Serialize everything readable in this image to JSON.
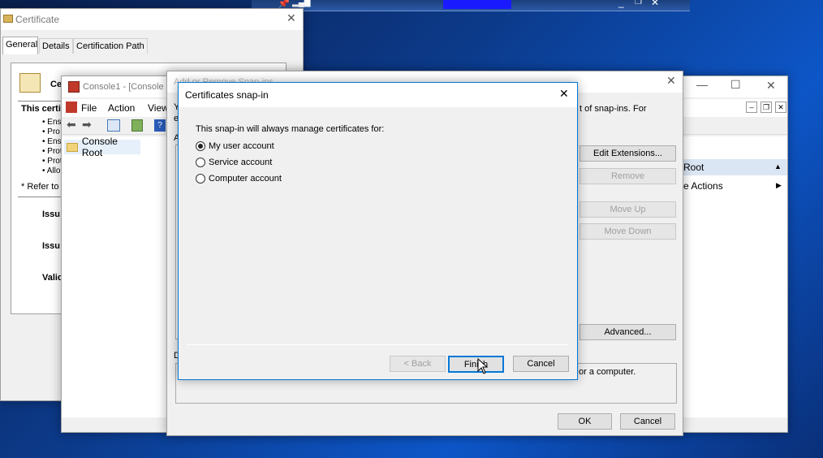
{
  "taskbar": {
    "title": ""
  },
  "certificate": {
    "title": "Certificate",
    "tabs": [
      "General",
      "Details",
      "Certification Path"
    ],
    "heading_fragment": "Ce",
    "info_fragment": "This certi",
    "bullets": [
      "• Ens",
      "• Pro",
      "• Ens",
      "• Prot",
      "• Prot",
      "• Allo"
    ],
    "refer_fragment": "* Refer to",
    "issued_fragment_1": "Issu",
    "issued_fragment_2": "Issu",
    "valid_fragment": "Valid"
  },
  "console": {
    "title": "Console1 - [Console",
    "menu": [
      "File",
      "Action",
      "View"
    ],
    "tree_root": "Console Root",
    "actions_root": "Root",
    "actions_more": "e Actions"
  },
  "snapins": {
    "title": "Add or Remove Snap-ins",
    "desc_fragment": "t of snap-ins. For",
    "desc_y": "Y",
    "desc_e": "e",
    "label_a": "A",
    "label_d": "D",
    "btn_edit_ext": "Edit Extensions...",
    "btn_remove": "Remove",
    "btn_move_up": "Move Up",
    "btn_move_down": "Move Down",
    "btn_advanced": "Advanced...",
    "description_fragment": "or a computer.",
    "btn_ok": "OK",
    "btn_cancel": "Cancel"
  },
  "dialog": {
    "title": "Certificates snap-in",
    "prompt": "This snap-in will always manage certificates for:",
    "options": [
      {
        "label": "My user account",
        "selected": true
      },
      {
        "label": "Service account",
        "selected": false
      },
      {
        "label": "Computer account",
        "selected": false
      }
    ],
    "btn_back": "< Back",
    "btn_finish": "Finish",
    "btn_cancel": "Cancel"
  }
}
